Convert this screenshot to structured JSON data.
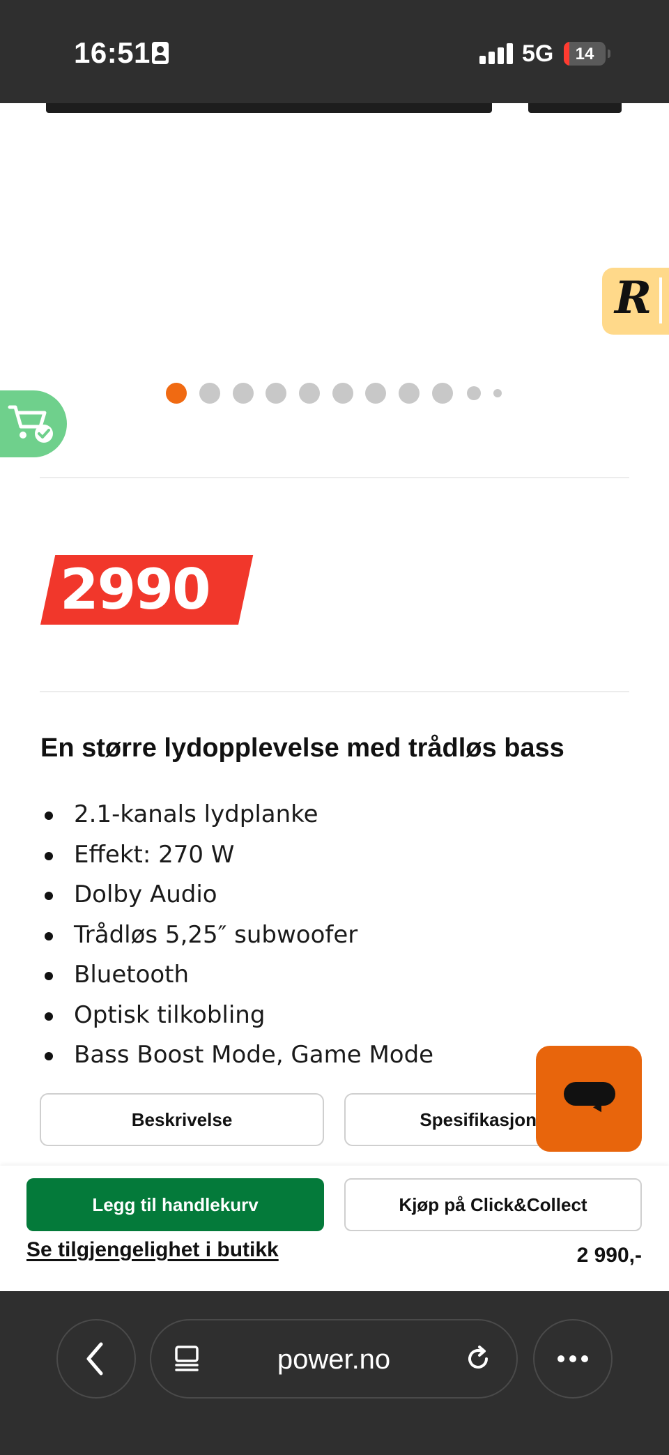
{
  "status_bar": {
    "time": "16:51",
    "network": "5G",
    "battery": "14",
    "battery_color": "#ff3b30"
  },
  "gallery": {
    "total_images": 11,
    "active_index": 0,
    "active_color": "#f06a12",
    "inactive_color": "#c8c8c8"
  },
  "product": {
    "price_badge": "2990",
    "heading": "En større lydopplevelse med trådløs bass",
    "features": [
      "2.1-kanals lydplanke",
      "Effekt: 270 W",
      "Dolby Audio",
      "Trådløs 5,25″ subwoofer",
      "Bluetooth",
      "Optisk tilkobling",
      "Bass Boost Mode, Game Mode"
    ]
  },
  "tabs": {
    "description": "Beskrivelse",
    "specifications": "Spesifikasjoner"
  },
  "sticky_bar": {
    "add_to_cart": "Legg til handlekurv",
    "click_collect": "Kjøp på Click&Collect",
    "availability_link": "Se tilgjengelighet i butikk",
    "price": "2 990,-"
  },
  "browser": {
    "url": "power.no"
  },
  "colors": {
    "brand_green": "#047a3a",
    "price_red": "#f1372b",
    "chat_orange": "#e8650c",
    "cart_fab_green": "#6fd08c",
    "r_badge_yellow": "#ffd98a"
  },
  "icons": {
    "status_id": "person-id-icon",
    "cart_fab": "cart-check-icon",
    "r_badge": "r-logo-icon",
    "chat": "chat-bubble-icon",
    "back": "chevron-left-icon",
    "tabs": "tabs-icon",
    "reload": "reload-icon",
    "more": "more-dots-icon"
  }
}
